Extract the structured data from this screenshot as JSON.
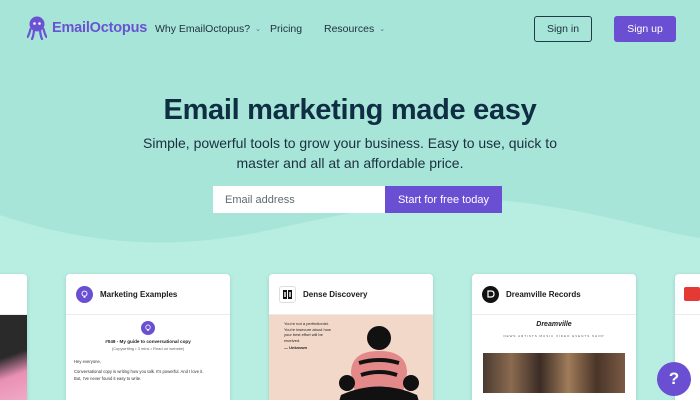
{
  "nav": {
    "brand": "EmailOctopus",
    "links": [
      {
        "label": "Why EmailOctopus?",
        "has_dropdown": true
      },
      {
        "label": "Pricing",
        "has_dropdown": false
      },
      {
        "label": "Resources",
        "has_dropdown": true
      }
    ],
    "sign_in": "Sign in",
    "sign_up": "Sign up"
  },
  "hero": {
    "title": "Email marketing made easy",
    "subtitle_line1": "Simple, powerful tools to grow your business. Easy to use, quick to",
    "subtitle_line2": "master and all at an affordable price."
  },
  "signup_form": {
    "email_placeholder": "Email address",
    "cta": "Start for free today"
  },
  "cards": [
    {
      "title": "Marketing Examples",
      "heading": "#049 - My guide to conversational copy",
      "sub": "(Copywriting • 3 mins • Read on website)",
      "greeting": "Hey everyone,",
      "line1": "Conversational copy is writing how you talk. It's powerful. And I love it.",
      "line2": "But, I've never found it easy to write."
    },
    {
      "title": "Dense Discovery",
      "quote": "You're not a perfectionist. You're insecure about how your best effort will be received.",
      "quote_author": "— Unknown"
    },
    {
      "title": "Dreamville Records",
      "brand_wordmark": "Dreamville",
      "menu": "NEWS  ARTISTS  MUSIC  VIDEO  EVENTS  SHOP"
    }
  ],
  "help_button": "?",
  "colors": {
    "background": "#a6e5d8",
    "wave": "#b8ede2",
    "accent": "#6a4fd2",
    "heading": "#0f2d43"
  },
  "icons": [
    "octopus-logo-icon",
    "chevron-down-icon",
    "lightbulb-icon",
    "help-icon"
  ]
}
